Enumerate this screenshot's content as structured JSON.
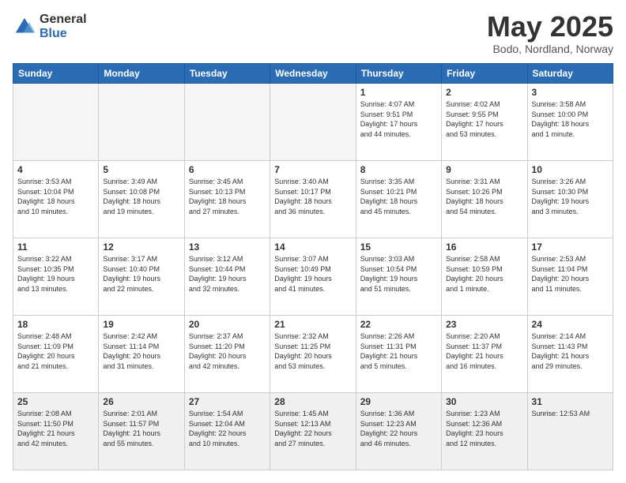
{
  "header": {
    "logo_general": "General",
    "logo_blue": "Blue",
    "month_title": "May 2025",
    "location": "Bodo, Nordland, Norway"
  },
  "days_of_week": [
    "Sunday",
    "Monday",
    "Tuesday",
    "Wednesday",
    "Thursday",
    "Friday",
    "Saturday"
  ],
  "weeks": [
    [
      {
        "day": "",
        "info": ""
      },
      {
        "day": "",
        "info": ""
      },
      {
        "day": "",
        "info": ""
      },
      {
        "day": "",
        "info": ""
      },
      {
        "day": "1",
        "info": "Sunrise: 4:07 AM\nSunset: 9:51 PM\nDaylight: 17 hours\nand 44 minutes."
      },
      {
        "day": "2",
        "info": "Sunrise: 4:02 AM\nSunset: 9:55 PM\nDaylight: 17 hours\nand 53 minutes."
      },
      {
        "day": "3",
        "info": "Sunrise: 3:58 AM\nSunset: 10:00 PM\nDaylight: 18 hours\nand 1 minute."
      }
    ],
    [
      {
        "day": "4",
        "info": "Sunrise: 3:53 AM\nSunset: 10:04 PM\nDaylight: 18 hours\nand 10 minutes."
      },
      {
        "day": "5",
        "info": "Sunrise: 3:49 AM\nSunset: 10:08 PM\nDaylight: 18 hours\nand 19 minutes."
      },
      {
        "day": "6",
        "info": "Sunrise: 3:45 AM\nSunset: 10:13 PM\nDaylight: 18 hours\nand 27 minutes."
      },
      {
        "day": "7",
        "info": "Sunrise: 3:40 AM\nSunset: 10:17 PM\nDaylight: 18 hours\nand 36 minutes."
      },
      {
        "day": "8",
        "info": "Sunrise: 3:35 AM\nSunset: 10:21 PM\nDaylight: 18 hours\nand 45 minutes."
      },
      {
        "day": "9",
        "info": "Sunrise: 3:31 AM\nSunset: 10:26 PM\nDaylight: 18 hours\nand 54 minutes."
      },
      {
        "day": "10",
        "info": "Sunrise: 3:26 AM\nSunset: 10:30 PM\nDaylight: 19 hours\nand 3 minutes."
      }
    ],
    [
      {
        "day": "11",
        "info": "Sunrise: 3:22 AM\nSunset: 10:35 PM\nDaylight: 19 hours\nand 13 minutes."
      },
      {
        "day": "12",
        "info": "Sunrise: 3:17 AM\nSunset: 10:40 PM\nDaylight: 19 hours\nand 22 minutes."
      },
      {
        "day": "13",
        "info": "Sunrise: 3:12 AM\nSunset: 10:44 PM\nDaylight: 19 hours\nand 32 minutes."
      },
      {
        "day": "14",
        "info": "Sunrise: 3:07 AM\nSunset: 10:49 PM\nDaylight: 19 hours\nand 41 minutes."
      },
      {
        "day": "15",
        "info": "Sunrise: 3:03 AM\nSunset: 10:54 PM\nDaylight: 19 hours\nand 51 minutes."
      },
      {
        "day": "16",
        "info": "Sunrise: 2:58 AM\nSunset: 10:59 PM\nDaylight: 20 hours\nand 1 minute."
      },
      {
        "day": "17",
        "info": "Sunrise: 2:53 AM\nSunset: 11:04 PM\nDaylight: 20 hours\nand 11 minutes."
      }
    ],
    [
      {
        "day": "18",
        "info": "Sunrise: 2:48 AM\nSunset: 11:09 PM\nDaylight: 20 hours\nand 21 minutes."
      },
      {
        "day": "19",
        "info": "Sunrise: 2:42 AM\nSunset: 11:14 PM\nDaylight: 20 hours\nand 31 minutes."
      },
      {
        "day": "20",
        "info": "Sunrise: 2:37 AM\nSunset: 11:20 PM\nDaylight: 20 hours\nand 42 minutes."
      },
      {
        "day": "21",
        "info": "Sunrise: 2:32 AM\nSunset: 11:25 PM\nDaylight: 20 hours\nand 53 minutes."
      },
      {
        "day": "22",
        "info": "Sunrise: 2:26 AM\nSunset: 11:31 PM\nDaylight: 21 hours\nand 5 minutes."
      },
      {
        "day": "23",
        "info": "Sunrise: 2:20 AM\nSunset: 11:37 PM\nDaylight: 21 hours\nand 16 minutes."
      },
      {
        "day": "24",
        "info": "Sunrise: 2:14 AM\nSunset: 11:43 PM\nDaylight: 21 hours\nand 29 minutes."
      }
    ],
    [
      {
        "day": "25",
        "info": "Sunrise: 2:08 AM\nSunset: 11:50 PM\nDaylight: 21 hours\nand 42 minutes."
      },
      {
        "day": "26",
        "info": "Sunrise: 2:01 AM\nSunset: 11:57 PM\nDaylight: 21 hours\nand 55 minutes."
      },
      {
        "day": "27",
        "info": "Sunrise: 1:54 AM\nSunset: 12:04 AM\nDaylight: 22 hours\nand 10 minutes."
      },
      {
        "day": "28",
        "info": "Sunrise: 1:45 AM\nSunset: 12:13 AM\nDaylight: 22 hours\nand 27 minutes."
      },
      {
        "day": "29",
        "info": "Sunrise: 1:36 AM\nSunset: 12:23 AM\nDaylight: 22 hours\nand 46 minutes."
      },
      {
        "day": "30",
        "info": "Sunrise: 1:23 AM\nSunset: 12:36 AM\nDaylight: 23 hours\nand 12 minutes."
      },
      {
        "day": "31",
        "info": "Sunrise: 12:53 AM"
      }
    ]
  ]
}
